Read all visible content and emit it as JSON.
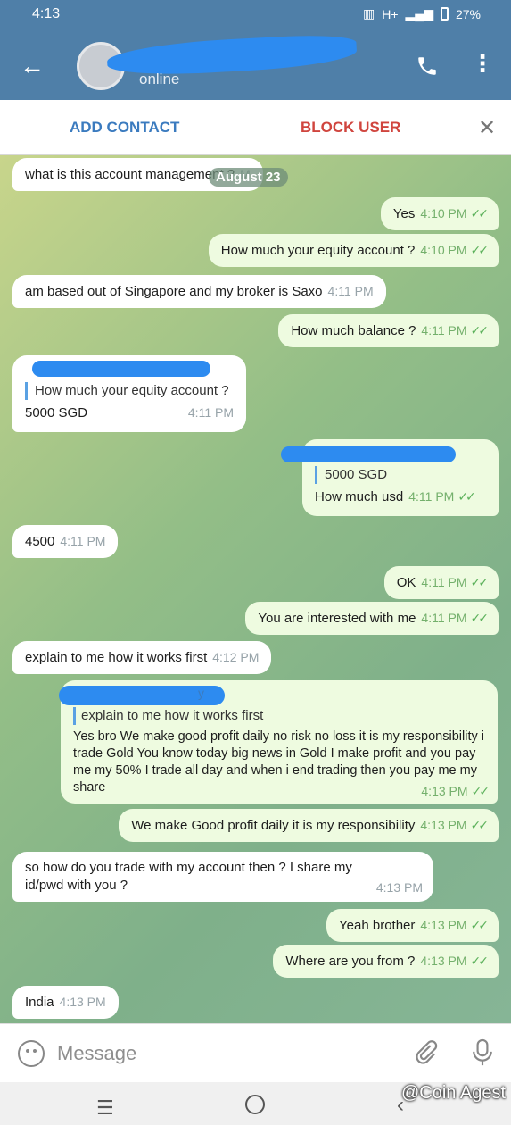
{
  "status_bar": {
    "time": "4:13",
    "signal": "H+",
    "battery": "27%"
  },
  "header": {
    "status": "online"
  },
  "actions": {
    "add_contact": "ADD CONTACT",
    "block_user": "BLOCK USER"
  },
  "date_pill": "August 23",
  "messages": [
    {
      "dir": "in",
      "text": "what is this account managem",
      "time": "ent ?",
      "tail": "M"
    },
    {
      "dir": "out",
      "text": "Yes",
      "time": "4:10 PM"
    },
    {
      "dir": "out",
      "text": "How much your equity account ?",
      "time": "4:10 PM"
    },
    {
      "dir": "in",
      "text": "am based out of Singapore and my broker is Saxo",
      "time": "4:11 PM"
    },
    {
      "dir": "out",
      "text": "How much balance ?",
      "time": "4:11 PM"
    },
    {
      "dir": "in",
      "quote": "How much your equity account ?",
      "text": "5000 SGD",
      "time": "4:11 PM"
    },
    {
      "dir": "out",
      "quote": "5000 SGD",
      "text": "How much usd",
      "time": "4:11 PM"
    },
    {
      "dir": "in",
      "text": "4500",
      "time": "4:11 PM"
    },
    {
      "dir": "out",
      "text": "OK",
      "time": "4:11 PM"
    },
    {
      "dir": "out",
      "text": "You are interested with me",
      "time": "4:11 PM"
    },
    {
      "dir": "in",
      "text": "explain to me how it works first",
      "time": "4:12 PM"
    },
    {
      "dir": "out",
      "quote_suffix": "y",
      "quote": "explain to me how it works first",
      "text": "Yes bro We make good profit daily no risk no loss it is my responsibility i trade Gold You know today big news in Gold I make profit and you pay me my 50% I trade all day and when i end trading then you pay me my share",
      "time": "4:13 PM"
    },
    {
      "dir": "out",
      "text": "We make Good profit daily it is my responsibility",
      "time": "4:13 PM"
    },
    {
      "dir": "in",
      "text": "so how do you trade with my account then ? I share my id/pwd with you ?",
      "time": "4:13 PM"
    },
    {
      "dir": "out",
      "text": "Yeah brother",
      "time": "4:13 PM"
    },
    {
      "dir": "out",
      "text": "Where are you from ?",
      "time": "4:13 PM"
    },
    {
      "dir": "in",
      "text": "India",
      "time": "4:13 PM"
    }
  ],
  "composer": {
    "placeholder": "Message"
  },
  "watermark": "@Coin Agest",
  "colors": {
    "header": "#4f7fa8",
    "outgoing": "#eefbe0",
    "incoming": "#ffffff",
    "check": "#5cb15b"
  }
}
